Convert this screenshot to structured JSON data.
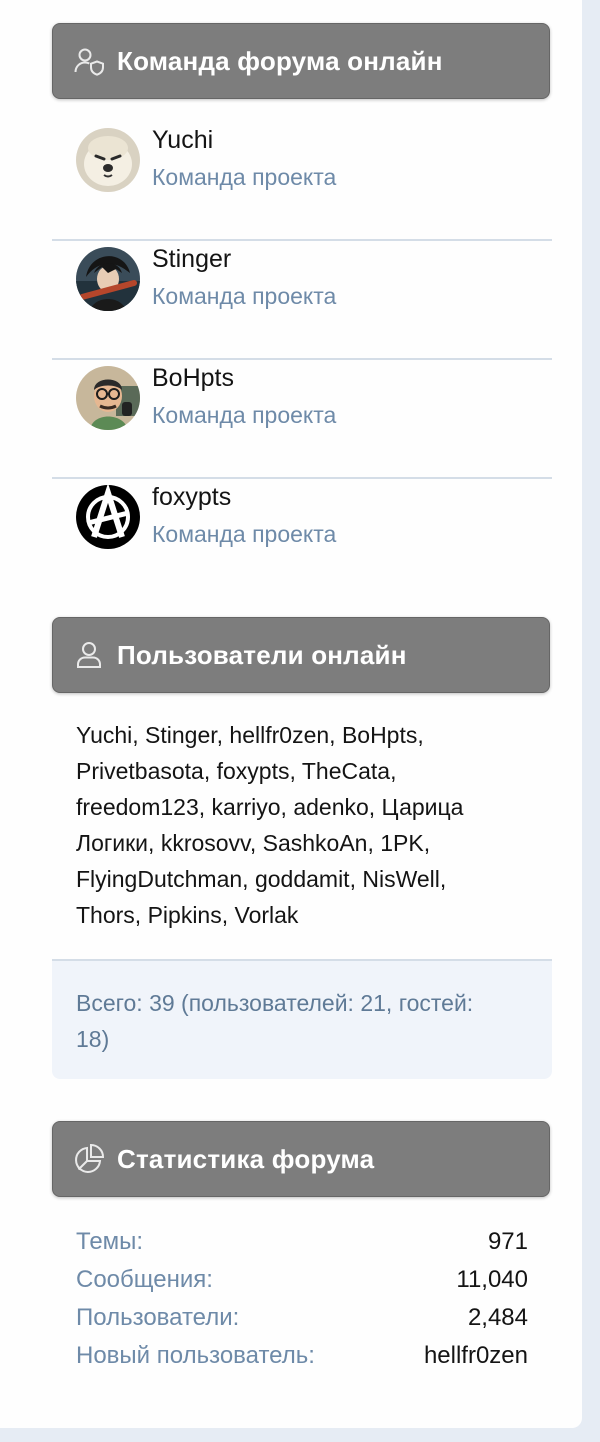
{
  "staff": {
    "title": "Команда форума онлайн",
    "icon": "user-shield-icon",
    "members": [
      {
        "name": "Yuchi",
        "role": "Команда проекта"
      },
      {
        "name": "Stinger",
        "role": "Команда проекта"
      },
      {
        "name": "BoHpts",
        "role": "Команда проекта"
      },
      {
        "name": "foxypts",
        "role": "Команда проекта"
      }
    ]
  },
  "online": {
    "title": "Пользователи онлайн",
    "icon": "user-icon",
    "users_text": "Yuchi, Stinger, hellfr0zen, BoHpts, Privetbasota, foxypts, TheCata, freedom123, karriyo, adenko, Царица Логики, kkrosovv, SashkoAn, 1PK, FlyingDutchman, goddamit, NisWell, Thors, Pipkins, Vorlak",
    "totals": "Всего: 39 (пользователей: 21, гостей: 18)"
  },
  "stats": {
    "title": "Статистика форума",
    "icon": "pie-chart-icon",
    "rows": [
      {
        "label": "Темы:",
        "value": "971"
      },
      {
        "label": "Сообщения:",
        "value": "11,040"
      },
      {
        "label": "Пользователи:",
        "value": "2,484"
      },
      {
        "label": "Новый пользователь:",
        "value": "hellfr0zen"
      }
    ]
  },
  "colors": {
    "header_bg": "#7d7d7d",
    "muted_text": "#6e8aa8",
    "footer_bg": "#f0f4fa"
  }
}
